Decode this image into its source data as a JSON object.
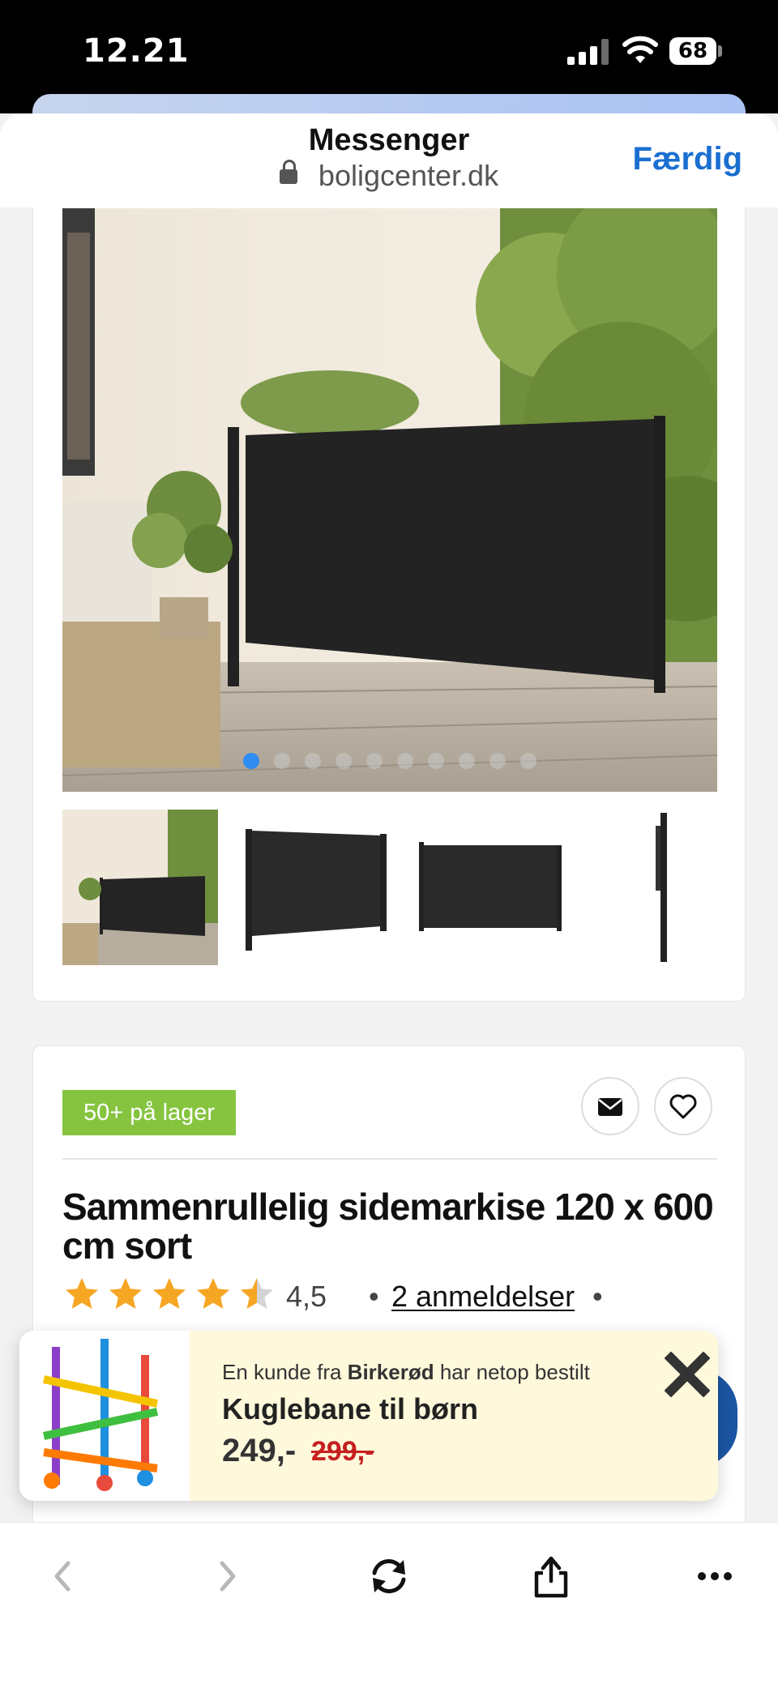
{
  "status_bar": {
    "time": "12.21",
    "battery": "68"
  },
  "browser": {
    "title": "Messenger",
    "url": "boligcenter.dk",
    "done_label": "Færdig"
  },
  "gallery": {
    "dot_count": 10,
    "active_dot": 0
  },
  "product": {
    "stock_badge": "50+ på lager",
    "title": "Sammenrullelig sidemarkise 120 x 600 cm sort",
    "rating_value": "4,5",
    "rating_stars": 4.5,
    "reviews_link": "2 anmeldelser",
    "separator": "•"
  },
  "toast": {
    "prefix": "En kunde fra",
    "city": "Birkerød",
    "suffix": "har netop bestilt",
    "product_name": "Kuglebane til børn",
    "price": "249,-",
    "old_price": "299,-"
  },
  "colors": {
    "accent": "#1a6fd0",
    "stock_green": "#86c440",
    "star": "#f5a623",
    "old_price": "#c62020"
  }
}
